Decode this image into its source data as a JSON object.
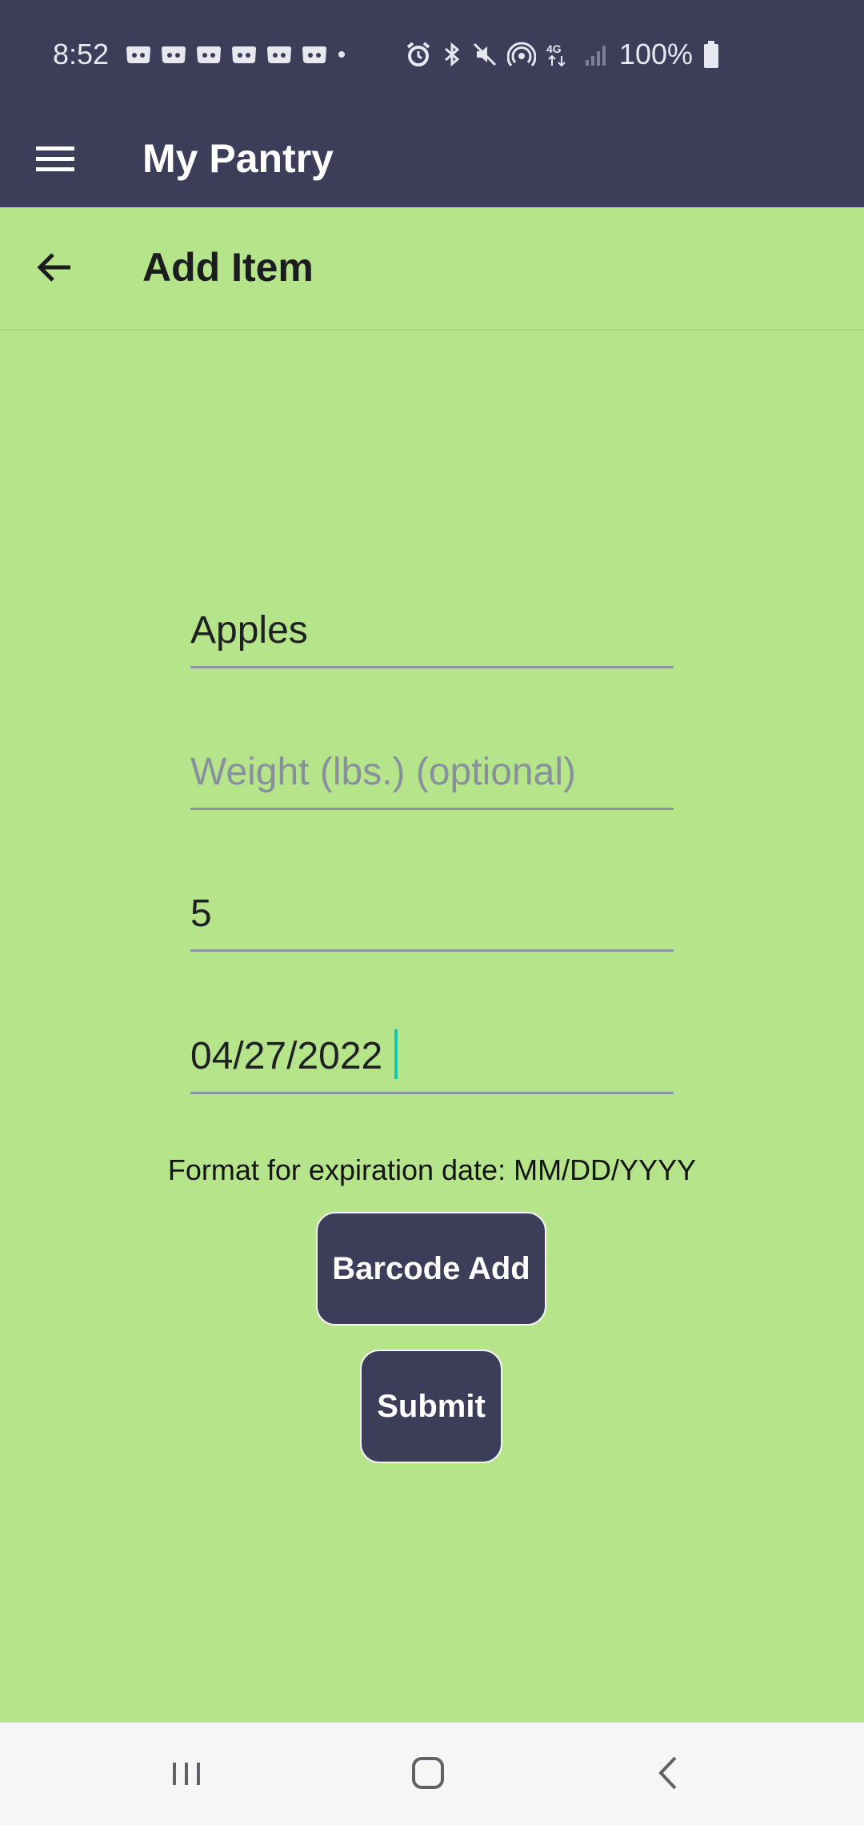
{
  "status_bar": {
    "time": "8:52",
    "battery": "100%",
    "notification_icons": [
      "discord-icon",
      "discord-icon",
      "discord-icon",
      "discord-icon",
      "discord-icon",
      "discord-icon",
      "dot-icon"
    ],
    "system_icons": [
      "alarm-icon",
      "bluetooth-icon",
      "mute-icon",
      "hotspot-icon",
      "lte-icon",
      "signal-icon",
      "battery-icon"
    ]
  },
  "app_bar": {
    "title": "My Pantry",
    "menu_icon": "menu-icon"
  },
  "page": {
    "title": "Add Item",
    "back_icon": "back-arrow-icon"
  },
  "form": {
    "name": {
      "value": "Apples",
      "placeholder": ""
    },
    "weight": {
      "value": "",
      "placeholder": "Weight (lbs.) (optional)"
    },
    "quantity": {
      "value": "5",
      "placeholder": ""
    },
    "expiration": {
      "value": "04/27/2022",
      "placeholder": ""
    },
    "hint": "Format for expiration date: MM/DD/YYYY"
  },
  "buttons": {
    "barcode": "Barcode Add",
    "submit": "Submit"
  },
  "nav_bar": {
    "recents_icon": "recents-icon",
    "home_icon": "home-icon",
    "back_icon": "nav-back-icon"
  },
  "colors": {
    "app_bar": "#3c3d59",
    "background": "#b6e48b",
    "button": "#3c3d59",
    "cursor": "#16c6a8",
    "nav_bar": "#f6f6f6"
  }
}
